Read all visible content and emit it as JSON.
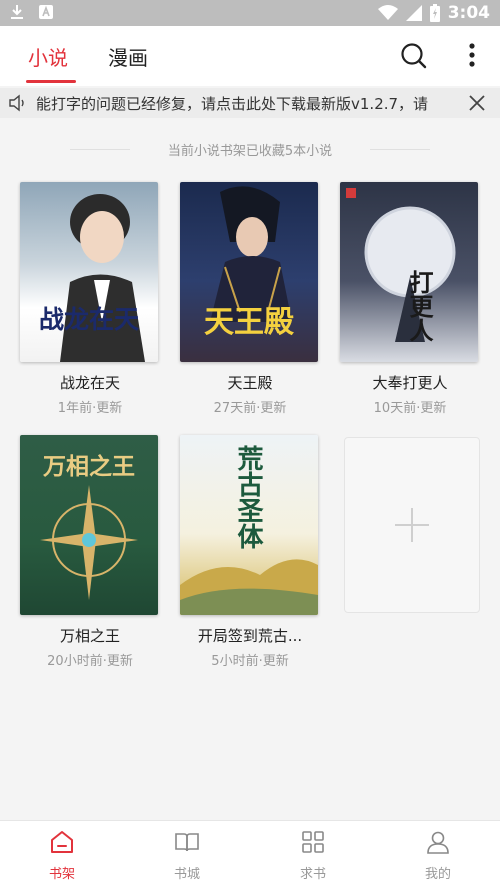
{
  "status_bar": {
    "time": "3:04"
  },
  "tabs": [
    {
      "label": "小说",
      "active": true
    },
    {
      "label": "漫画",
      "active": false
    }
  ],
  "notice": {
    "text": "能打字的问题已经修复，请点击此处下载最新版v1.2.7，请"
  },
  "shelf_status": "当前小说书架已收藏5本小说",
  "books": [
    {
      "title": "战龙在天",
      "updated": "1年前·更新",
      "cover_text": "战龙在天"
    },
    {
      "title": "天王殿",
      "updated": "27天前·更新",
      "cover_text": "天王殿"
    },
    {
      "title": "大奉打更人",
      "updated": "10天前·更新",
      "cover_text": "打更人"
    },
    {
      "title": "万相之王",
      "updated": "20小时前·更新",
      "cover_text": "万相之王"
    },
    {
      "title": "开局签到荒古...",
      "updated": "5小时前·更新",
      "cover_text": "荒古圣体"
    }
  ],
  "bottom_nav": [
    {
      "label": "书架",
      "icon": "bookshelf-icon",
      "active": true
    },
    {
      "label": "书城",
      "icon": "book-store-icon",
      "active": false
    },
    {
      "label": "求书",
      "icon": "request-book-icon",
      "active": false
    },
    {
      "label": "我的",
      "icon": "profile-icon",
      "active": false
    }
  ],
  "colors": {
    "accent": "#e2333c",
    "muted": "#999999"
  }
}
